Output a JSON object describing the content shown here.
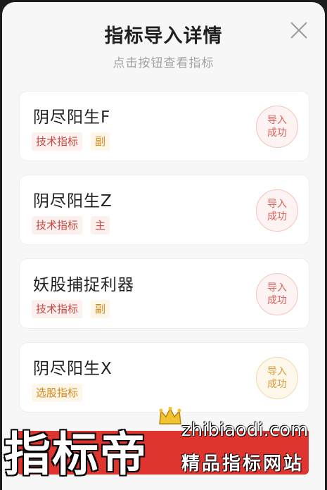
{
  "header": {
    "title": "指标导入详情",
    "subtitle": "点击按钮查看指标",
    "close_icon": "close-icon"
  },
  "items": [
    {
      "name": "阴尽阳生F",
      "type_tag": "技术指标",
      "role_tag": "副",
      "status": "导入成功",
      "status_color": "#d9625a"
    },
    {
      "name": "阴尽阳生Z",
      "type_tag": "技术指标",
      "role_tag": "主",
      "status": "导入成功",
      "status_color": "#d9625a"
    },
    {
      "name": "妖股捕捉利器",
      "type_tag": "技术指标",
      "role_tag": "副",
      "status": "导入成功",
      "status_color": "#d9625a"
    },
    {
      "name": "阴尽阳生X",
      "type_tag": "选股指标",
      "role_tag": "",
      "status": "导入成功",
      "status_color": "#dd9a34"
    }
  ],
  "watermark": {
    "brand": "指标帝",
    "url": "zhibiaodi.com",
    "slogan": "精品指标网站",
    "crown_icon": "crown-icon"
  },
  "colors": {
    "accent_red": "#c8463e",
    "accent_orange": "#d48a1c",
    "watermark_red": "#e0352e"
  }
}
